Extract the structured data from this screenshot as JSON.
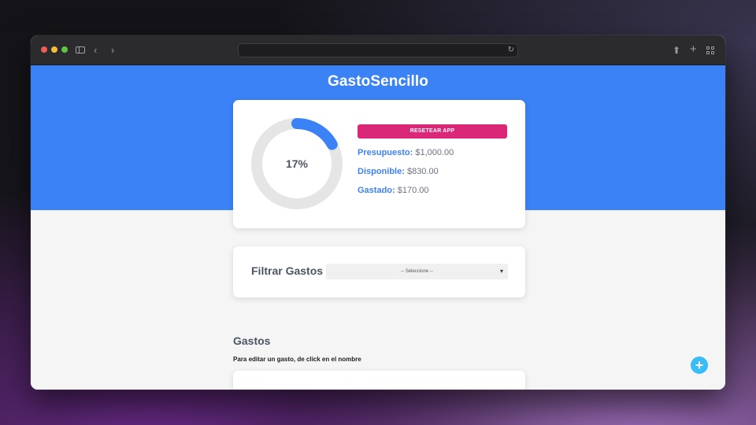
{
  "browser": {
    "url": "",
    "icons": [
      "sidebar-toggle-icon",
      "back-icon",
      "forward-icon",
      "reload-icon",
      "share-icon",
      "new-tab-icon",
      "tab-overview-icon"
    ]
  },
  "app": {
    "title": "GastoSencillo"
  },
  "budget": {
    "progress_percent": 17,
    "progress_label": "17%",
    "reset_label": "RESETEAR APP",
    "presupuesto_label": "Presupuesto:",
    "presupuesto_value": "$1,000.00",
    "disponible_label": "Disponible:",
    "disponible_value": "$830.00",
    "gastado_label": "Gastado:",
    "gastado_value": "$170.00"
  },
  "filter": {
    "label": "Filtrar Gastos",
    "selected": "-- Seleccione --"
  },
  "expenses": {
    "title": "Gastos",
    "hint": "Para editar un gasto, de click en el nombre"
  },
  "fab": {
    "label": "+"
  },
  "colors": {
    "primary": "#3b82f6",
    "reset": "#db2777",
    "fab": "#38bdf8",
    "track": "#e5e5e5"
  }
}
